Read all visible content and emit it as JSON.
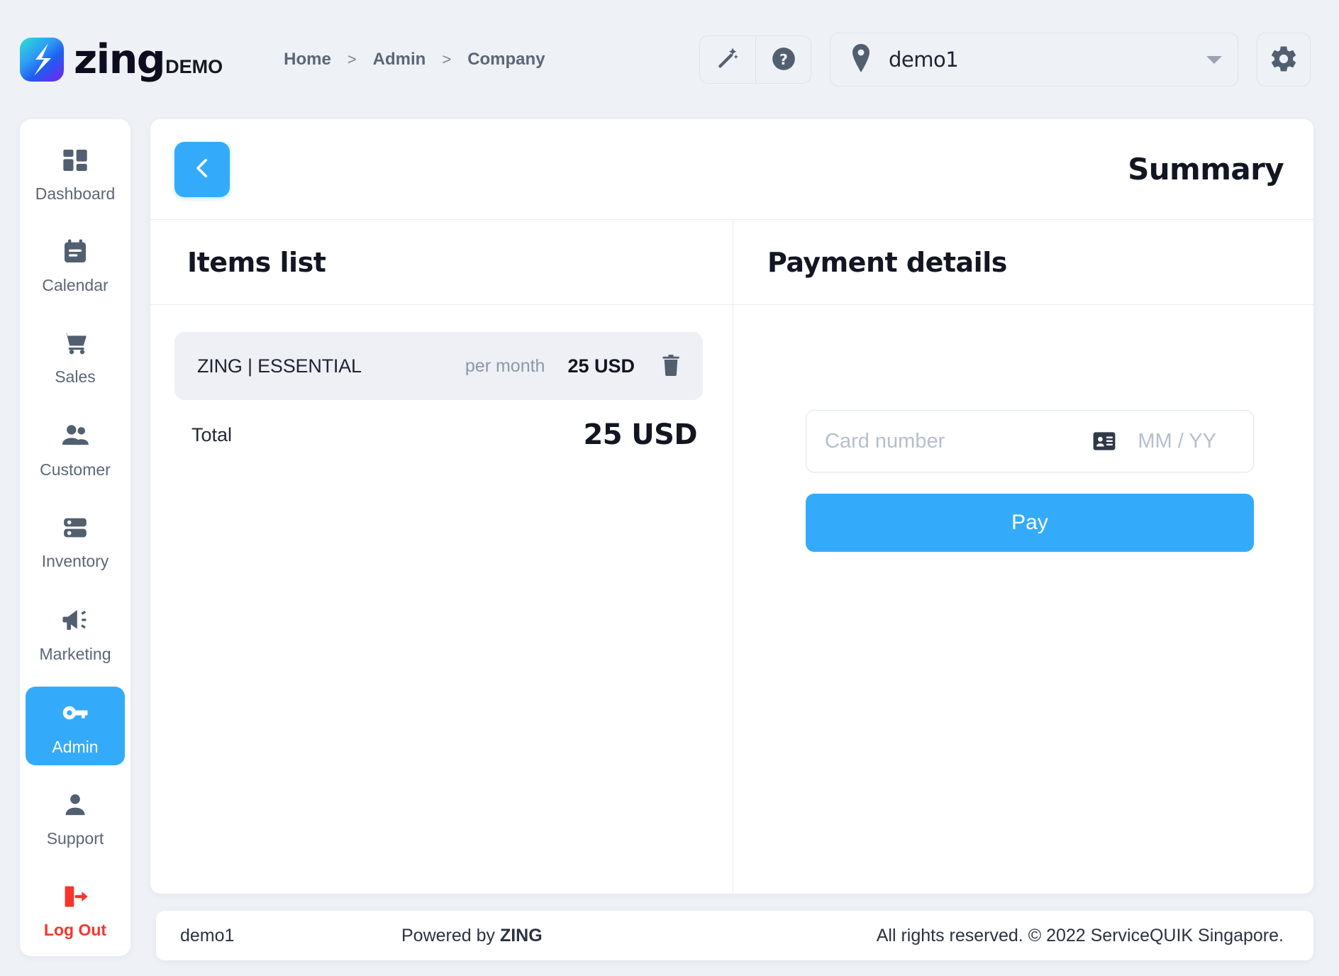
{
  "brand": {
    "logo_icon": "zing-bolt-logo",
    "name": "zing",
    "suffix": "DEMO",
    "accent": "#34abfa",
    "logout_color": "#f6352c"
  },
  "breadcrumb": {
    "items": [
      "Home",
      "Admin",
      "Company"
    ],
    "separator": ">"
  },
  "topbar": {
    "wand_icon": "magic-wand-icon",
    "help_icon": "help-circle-icon",
    "location_icon": "location-pin-icon",
    "location_value": "demo1",
    "gear_icon": "gear-icon"
  },
  "sidebar": {
    "items": [
      {
        "label": "Dashboard",
        "icon": "dashboard-grid-icon",
        "active": false
      },
      {
        "label": "Calendar",
        "icon": "calendar-icon",
        "active": false
      },
      {
        "label": "Sales",
        "icon": "shopping-cart-icon",
        "active": false
      },
      {
        "label": "Customer",
        "icon": "people-icon",
        "active": false
      },
      {
        "label": "Inventory",
        "icon": "server-stack-icon",
        "active": false
      },
      {
        "label": "Marketing",
        "icon": "megaphone-icon",
        "active": false
      },
      {
        "label": "Admin",
        "icon": "key-icon",
        "active": true
      },
      {
        "label": "Support",
        "icon": "person-icon",
        "active": false
      },
      {
        "label": "Log Out",
        "icon": "logout-door-icon",
        "active": false
      }
    ]
  },
  "main": {
    "back_icon": "chevron-left-icon",
    "title": "Summary",
    "items_pane": {
      "title": "Items list",
      "rows": [
        {
          "name": "ZING | ESSENTIAL",
          "period": "per month",
          "price": "25 USD",
          "delete_icon": "trash-icon"
        }
      ],
      "total_label": "Total",
      "total_value": "25 USD"
    },
    "payment_pane": {
      "title": "Payment details",
      "card_placeholder": "Card number",
      "card_value": "",
      "card_icon": "card-id-icon",
      "expiry_placeholder": "MM / YY",
      "expiry_value": "",
      "pay_label": "Pay"
    }
  },
  "footer": {
    "tenant": "demo1",
    "powered_prefix": "Powered by ",
    "powered_brand": "ZING",
    "copyright": "All rights reserved. © 2022 ServiceQUIK Singapore."
  }
}
